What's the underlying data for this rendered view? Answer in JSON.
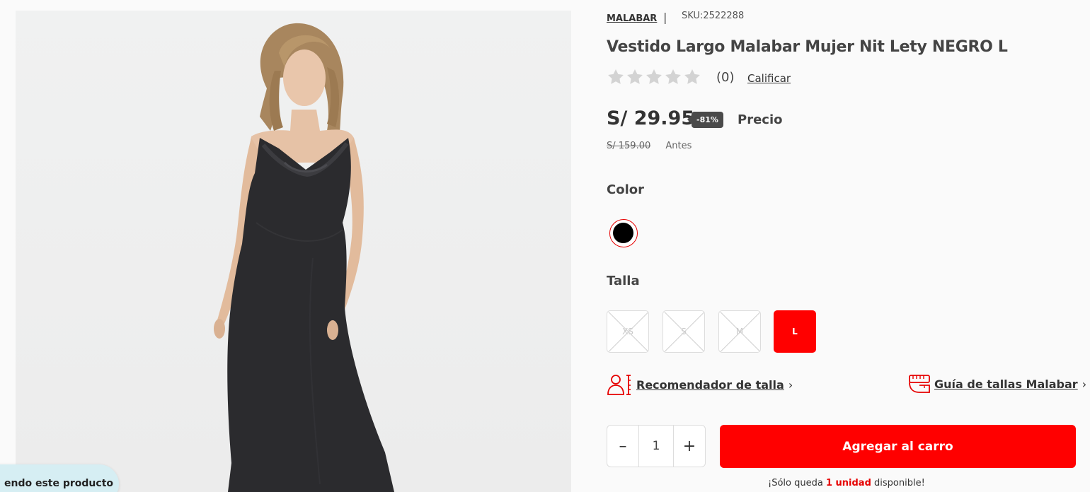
{
  "product": {
    "brand": "MALABAR",
    "separator": "|",
    "sku": "SKU:2522288",
    "title": "Vestido Largo Malabar Mujer Nit Lety NEGRO L",
    "rating": {
      "stars_filled": 0,
      "stars_total": 5,
      "count": "(0)",
      "rate_link": "Calificar"
    },
    "price": {
      "current": "S/ 29.95",
      "discount": "-81%",
      "current_label": "Precio",
      "original": "S/ 159.00",
      "original_label": "Antes"
    }
  },
  "color": {
    "label": "Color",
    "selected_swatch": "#000000"
  },
  "size": {
    "label": "Talla",
    "options": [
      {
        "label": "XS",
        "state": "unavailable"
      },
      {
        "label": "S",
        "state": "unavailable"
      },
      {
        "label": "M",
        "state": "unavailable"
      },
      {
        "label": "L",
        "state": "selected"
      }
    ]
  },
  "helpers": {
    "recommender": "Recomendador de talla",
    "guide": "Guía de tallas Malabar",
    "recommender_icon": "person-ruler-icon",
    "guide_icon": "measuring-tape-icon"
  },
  "cart": {
    "quantity": "1",
    "minus": "–",
    "plus": "+",
    "add_button": "Agregar al carro"
  },
  "stock": {
    "prefix": "¡Sólo queda ",
    "highlight": "1 unidad",
    "suffix": " disponible!"
  },
  "viewers_pill": "endo este producto",
  "colors": {
    "accent": "#ff0000",
    "badge": "#4a4a4a",
    "star_empty": "#d3d3d3",
    "pill_bg": "#d6eef3"
  }
}
